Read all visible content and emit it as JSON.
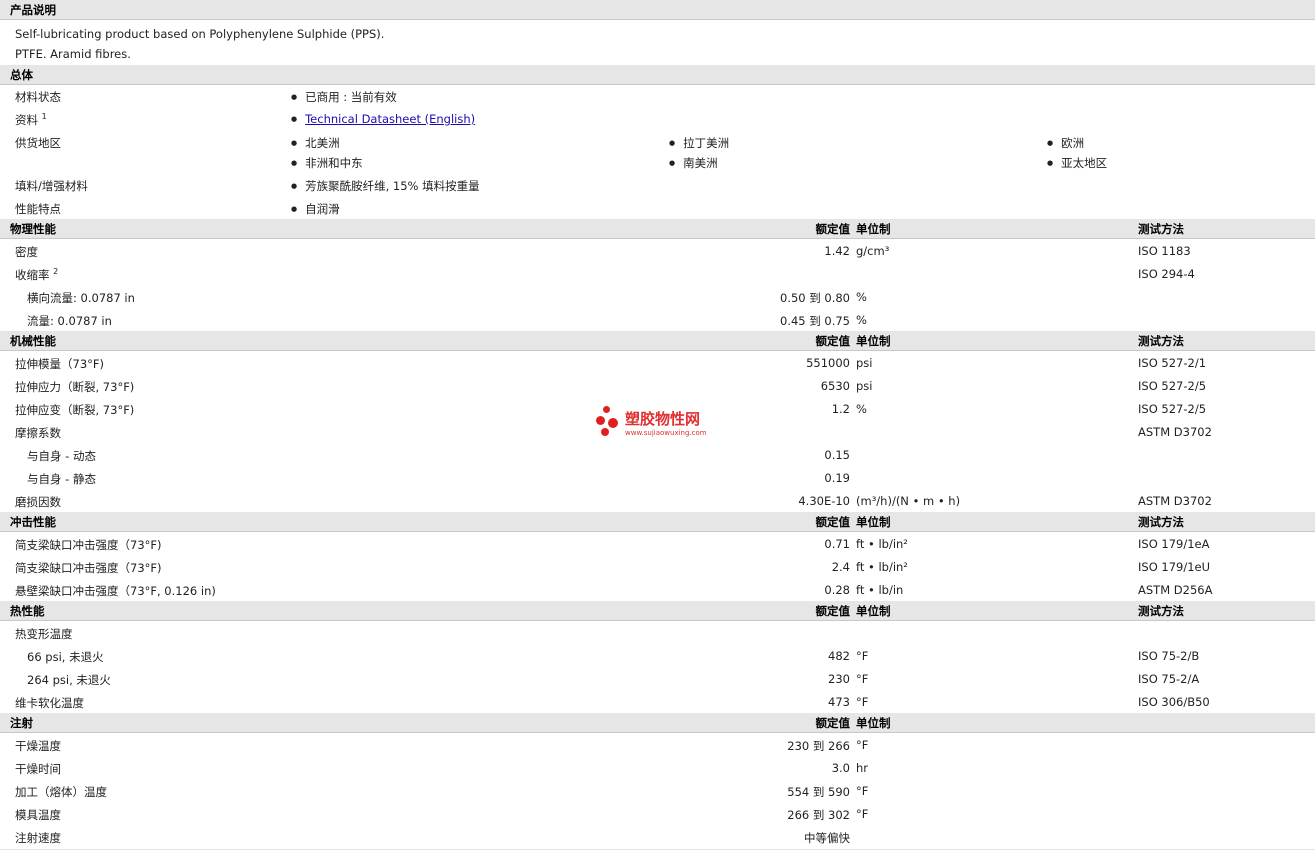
{
  "description": {
    "header": "产品说明",
    "lines": [
      "Self-lubricating product based on Polyphenylene Sulphide (PPS).",
      "PTFE. Aramid fibres."
    ]
  },
  "general": {
    "header": "总体",
    "status_label": "材料状态",
    "status_value": "已商用 : 当前有效",
    "docs_label": "资料",
    "docs_sup": "1",
    "docs_link": "Technical Datasheet (English)",
    "regions_label": "供货地区",
    "regions": [
      "北美洲",
      "拉丁美洲",
      "欧洲",
      "非洲和中东",
      "南美洲",
      "亚太地区"
    ],
    "filler_label": "填料/增强材料",
    "filler_value": "芳族聚酰胺纤维, 15% 填料按重量",
    "features_label": "性能特点",
    "features_value": "自润滑"
  },
  "columns": {
    "nominal": "额定值",
    "unit": "单位制",
    "test": "测试方法"
  },
  "physical": {
    "header": "物理性能",
    "rows": [
      {
        "label": "密度",
        "value": "1.42",
        "unit": "g/cm³",
        "test": "ISO 1183"
      },
      {
        "label": "收缩率",
        "sup": "2",
        "value": "",
        "unit": "",
        "test": "ISO 294-4"
      },
      {
        "label": "横向流量: 0.0787 in",
        "value": "0.50 到  0.80",
        "unit": "%",
        "test": ""
      },
      {
        "label": "流量: 0.0787 in",
        "value": "0.45 到  0.75",
        "unit": "%",
        "test": ""
      }
    ]
  },
  "mechanical": {
    "header": "机械性能",
    "rows": [
      {
        "label": "拉伸模量（73°F)",
        "value": "551000",
        "unit": "psi",
        "test": "ISO 527-2/1"
      },
      {
        "label": "拉伸应力（断裂, 73°F)",
        "value": "6530",
        "unit": "psi",
        "test": "ISO 527-2/5"
      },
      {
        "label": "拉伸应变（断裂, 73°F)",
        "value": "1.2",
        "unit": "%",
        "test": "ISO 527-2/5"
      },
      {
        "label": "摩擦系数",
        "value": "",
        "unit": "",
        "test": "ASTM D3702"
      },
      {
        "label": "与自身  - 动态",
        "value": "0.15",
        "unit": "",
        "test": ""
      },
      {
        "label": "与自身  - 静态",
        "value": "0.19",
        "unit": "",
        "test": ""
      },
      {
        "label": "磨损因数",
        "value": "4.30E-10",
        "unit": "(m³/h)/(N • m • h)",
        "test": "ASTM D3702"
      }
    ]
  },
  "impact": {
    "header": "冲击性能",
    "rows": [
      {
        "label": "简支梁缺口冲击强度（73°F)",
        "value": "0.71",
        "unit": "ft • lb/in²",
        "test": "ISO 179/1eA"
      },
      {
        "label": "简支梁缺口冲击强度（73°F)",
        "value": "2.4",
        "unit": "ft • lb/in²",
        "test": "ISO 179/1eU"
      },
      {
        "label": "悬壁梁缺口冲击强度（73°F, 0.126 in)",
        "value": "0.28",
        "unit": "ft • lb/in",
        "test": "ASTM D256A"
      }
    ]
  },
  "thermal": {
    "header": "热性能",
    "rows": [
      {
        "label": "热变形温度",
        "value": "",
        "unit": "",
        "test": ""
      },
      {
        "label": "66 psi, 未退火",
        "value": "482",
        "unit": "°F",
        "test": "ISO 75-2/B"
      },
      {
        "label": "264 psi, 未退火",
        "value": "230",
        "unit": "°F",
        "test": "ISO 75-2/A"
      },
      {
        "label": "维卡软化温度",
        "value": "473",
        "unit": "°F",
        "test": "ISO 306/B50"
      }
    ]
  },
  "injection": {
    "header": "注射",
    "rows": [
      {
        "label": "干燥温度",
        "value": "230 到  266",
        "unit": "°F"
      },
      {
        "label": "干燥时间",
        "value": "3.0",
        "unit": "hr"
      },
      {
        "label": "加工（熔体）温度",
        "value": "554 到  590",
        "unit": "°F"
      },
      {
        "label": "模具温度",
        "value": "266 到  302",
        "unit": "°F"
      },
      {
        "label": "注射速度",
        "value": "中等偏快",
        "unit": ""
      }
    ]
  },
  "watermark": {
    "title": "塑胶物性网",
    "url": "www.sujiaowuxing.com",
    "color": "#e03030"
  }
}
